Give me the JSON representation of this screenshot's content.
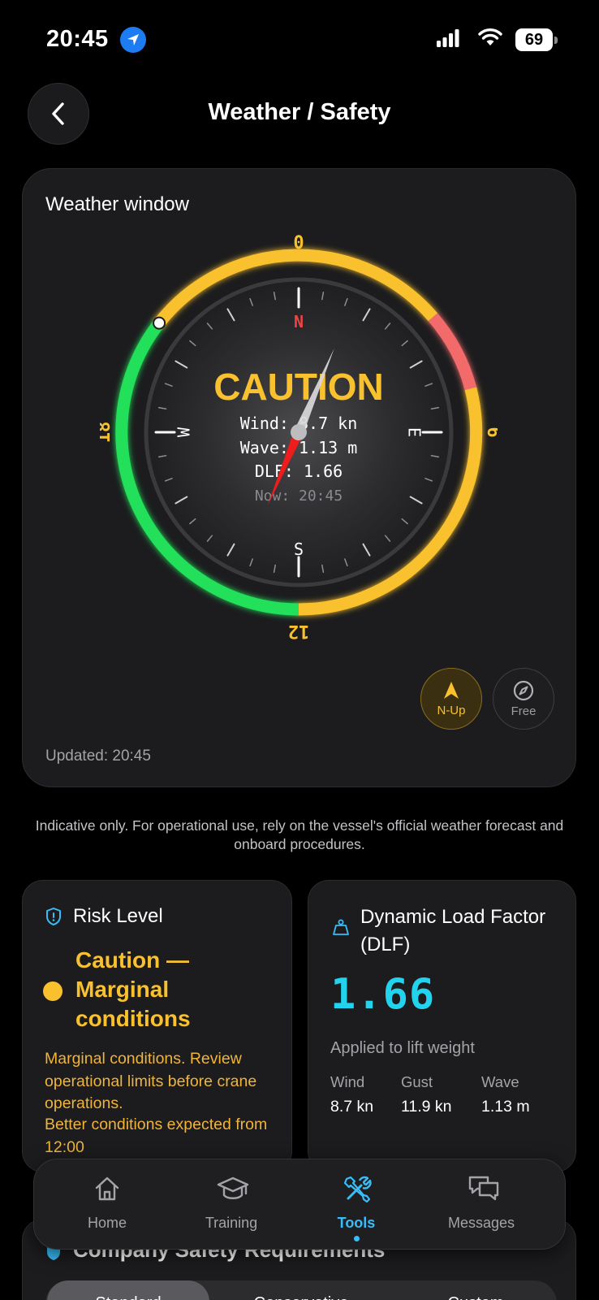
{
  "status_bar": {
    "time": "20:45",
    "battery": "69"
  },
  "header": {
    "title": "Weather / Safety"
  },
  "weather_card": {
    "title": "Weather window",
    "hour_labels": {
      "top": "0",
      "right": "6",
      "bottom": "12",
      "left": "18"
    },
    "directions": {
      "n": "N",
      "e": "E",
      "s": "S",
      "w": "W"
    },
    "status": "CAUTION",
    "wind_line": "Wind: 8.7 kn",
    "wave_line": "Wave: 1.13 m",
    "dlf_line": "DLF: 1.66",
    "now_line": "Now: 20:45",
    "mode_up_label": "N-Up",
    "mode_free_label": "Free",
    "updated": "Updated: 20:45",
    "colors": {
      "caution": "#f9c12e",
      "danger": "#f26b6b",
      "good": "#22e05a"
    }
  },
  "disclaimer": "Indicative only. For operational use, rely on the vessel's official weather forecast and onboard procedures.",
  "risk": {
    "title": "Risk Level",
    "level": "Caution — Marginal conditions",
    "description": "Marginal conditions. Review operational limits before crane operations.",
    "outlook": "Better conditions expected from 12:00"
  },
  "dlf": {
    "title": "Dynamic Load Factor (DLF)",
    "value": "1.66",
    "subtitle": "Applied to lift weight",
    "metrics": [
      {
        "label": "Wind",
        "value": "8.7 kn"
      },
      {
        "label": "Gust",
        "value": "11.9 kn"
      },
      {
        "label": "Wave",
        "value": "1.13 m"
      }
    ]
  },
  "company": {
    "title": "Company Safety Requirements",
    "segments": [
      "Standard",
      "Conservative",
      "Custom"
    ]
  },
  "tab_bar": {
    "tabs": [
      {
        "label": "Home",
        "icon": "home-icon"
      },
      {
        "label": "Training",
        "icon": "graduation-cap-icon"
      },
      {
        "label": "Tools",
        "icon": "tools-icon",
        "active": true
      },
      {
        "label": "Messages",
        "icon": "messages-icon"
      }
    ]
  }
}
